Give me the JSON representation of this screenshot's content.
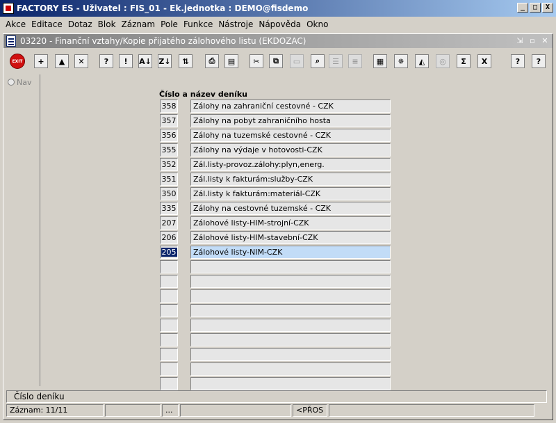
{
  "window": {
    "title": "FACTORY ES - Uživatel : FIS_01 - Ek.jednotka : DEMO@fisdemo",
    "buttons": [
      "_",
      "□",
      "X"
    ]
  },
  "menu": [
    "Akce",
    "Editace",
    "Dotaz",
    "Blok",
    "Záznam",
    "Pole",
    "Funkce",
    "Nástroje",
    "Nápověda",
    "Okno"
  ],
  "form": {
    "title": "03220 - Finanční vztahy/Kopie přijatého zálohového listu (EKDOZAC)",
    "buttons": [
      "⇲",
      "▫",
      "✕"
    ]
  },
  "toolbar": [
    {
      "icon": "exit-icon",
      "label": "EXIT",
      "enabled": true
    },
    {
      "icon": "insert-record-icon",
      "label": "+",
      "enabled": true
    },
    {
      "icon": "save-record-icon",
      "label": "▲",
      "enabled": true
    },
    {
      "icon": "delete-record-icon",
      "label": "✕",
      "enabled": true
    },
    {
      "icon": "enter-query-icon",
      "label": "?",
      "enabled": true
    },
    {
      "icon": "execute-query-icon",
      "label": "!",
      "enabled": true
    },
    {
      "icon": "sort-ascending-icon",
      "label": "A↓",
      "enabled": true
    },
    {
      "icon": "sort-descending-icon",
      "label": "Z↓",
      "enabled": true
    },
    {
      "icon": "sort-multi-icon",
      "label": "⇅",
      "enabled": true
    },
    {
      "icon": "print-icon",
      "label": "⎙",
      "enabled": true
    },
    {
      "icon": "print-preview-icon",
      "label": "▤",
      "enabled": true
    },
    {
      "icon": "cut-icon",
      "label": "✂",
      "enabled": true
    },
    {
      "icon": "copy-icon",
      "label": "⧉",
      "enabled": true
    },
    {
      "icon": "paste-icon",
      "label": "▭",
      "enabled": false
    },
    {
      "icon": "find-icon",
      "label": "⌕",
      "enabled": true
    },
    {
      "icon": "list-values-icon",
      "label": "☰",
      "enabled": false
    },
    {
      "icon": "edit-field-icon",
      "label": "≡",
      "enabled": false
    },
    {
      "icon": "calculator-icon",
      "label": "▦",
      "enabled": true
    },
    {
      "icon": "wheel-icon",
      "label": "✵",
      "enabled": true
    },
    {
      "icon": "triangle-icon",
      "label": "◭",
      "enabled": true
    },
    {
      "icon": "stamp-icon",
      "label": "◎",
      "enabled": false
    },
    {
      "icon": "sum-icon",
      "label": "Σ",
      "enabled": true
    },
    {
      "icon": "excel-icon",
      "label": "X",
      "enabled": true
    },
    {
      "icon": "help-icon",
      "label": "?",
      "enabled": true
    },
    {
      "icon": "context-help-icon",
      "label": "?",
      "enabled": true
    }
  ],
  "nav": {
    "label": "Nav"
  },
  "table": {
    "header": "Číslo a název deníku",
    "rows": [
      {
        "num": "358",
        "name": "Zálohy na zahraniční cestovné - CZK"
      },
      {
        "num": "357",
        "name": "Zálohy na pobyt zahraničního hosta"
      },
      {
        "num": "356",
        "name": "Zálohy na tuzemské cestovné - CZK"
      },
      {
        "num": "355",
        "name": "Zálohy na výdaje v hotovosti-CZK"
      },
      {
        "num": "352",
        "name": "Zál.listy-provoz.zálohy:plyn,energ."
      },
      {
        "num": "351",
        "name": "Zál.listy k fakturám:služby-CZK"
      },
      {
        "num": "350",
        "name": "Zál.listy k fakturám:materiál-CZK"
      },
      {
        "num": "335",
        "name": "Zálohy na cestovné tuzemské - CZK"
      },
      {
        "num": "207",
        "name": "Zálohové listy-HIM-strojní-CZK"
      },
      {
        "num": "206",
        "name": "Zálohové listy-HIM-stavební-CZK"
      },
      {
        "num": "205",
        "name": "Zálohové listy-NIM-CZK"
      },
      {
        "num": "",
        "name": ""
      },
      {
        "num": "",
        "name": ""
      },
      {
        "num": "",
        "name": ""
      },
      {
        "num": "",
        "name": ""
      },
      {
        "num": "",
        "name": ""
      },
      {
        "num": "",
        "name": ""
      },
      {
        "num": "",
        "name": ""
      },
      {
        "num": "",
        "name": ""
      },
      {
        "num": "",
        "name": ""
      }
    ],
    "selected_index": 10
  },
  "status": {
    "hint": "Číslo deníku",
    "record": "Záznam: 11/11",
    "seg2": "",
    "seg3": "...",
    "seg4": "",
    "seg5": "<PŘOS",
    "seg6": ""
  }
}
